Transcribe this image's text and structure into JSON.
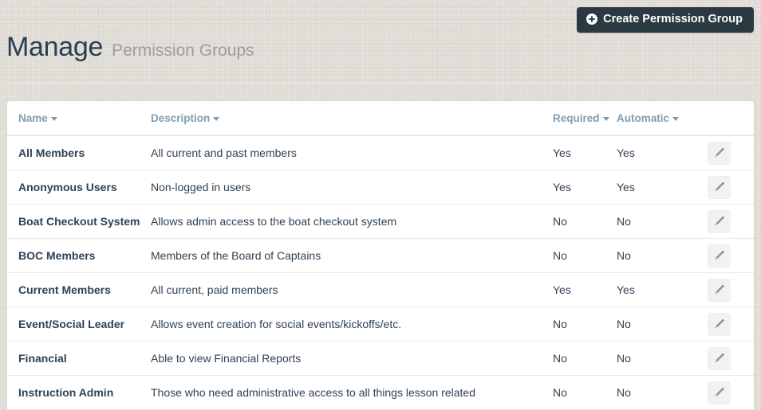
{
  "header": {
    "title_main": "Manage",
    "title_sub": "Permission Groups",
    "create_button": {
      "label": "Create Permission Group",
      "icon": "plus-circle-icon",
      "bg_color": "#2b3a42",
      "text_color": "#ffffff"
    }
  },
  "theme": {
    "page_bg": "#dedcd5",
    "card_bg": "#ffffff",
    "header_text": "#7d9cb3",
    "title_color": "#2c3e50",
    "subtitle_color": "#9d9d9d",
    "row_border": "#e8e8e8"
  },
  "table": {
    "columns": [
      {
        "label": "Name",
        "sortable": true,
        "icon": "caret-down-icon"
      },
      {
        "label": "Description",
        "sortable": true,
        "icon": "caret-down-icon"
      },
      {
        "label": "Required",
        "sortable": true,
        "icon": "caret-down-icon"
      },
      {
        "label": "Automatic",
        "sortable": true,
        "icon": "caret-down-icon"
      },
      {
        "label": "",
        "sortable": false,
        "icon": ""
      }
    ],
    "row_action_icon": "pencil-icon",
    "rows": [
      {
        "name": "All Members",
        "description": "All current and past members",
        "required": "Yes",
        "automatic": "Yes"
      },
      {
        "name": "Anonymous Users",
        "description": "Non-logged in users",
        "required": "Yes",
        "automatic": "Yes"
      },
      {
        "name": "Boat Checkout System",
        "description": "Allows admin access to the boat checkout system",
        "required": "No",
        "automatic": "No"
      },
      {
        "name": "BOC Members",
        "description": "Members of the Board of Captains",
        "required": "No",
        "automatic": "No"
      },
      {
        "name": "Current Members",
        "description": "All current, paid members",
        "required": "Yes",
        "automatic": "Yes"
      },
      {
        "name": "Event/Social Leader",
        "description": "Allows event creation for social events/kickoffs/etc.",
        "required": "No",
        "automatic": "No"
      },
      {
        "name": "Financial",
        "description": "Able to view Financial Reports",
        "required": "No",
        "automatic": "No"
      },
      {
        "name": "Instruction Admin",
        "description": "Those who need administrative access to all things lesson related",
        "required": "No",
        "automatic": "No"
      }
    ]
  }
}
